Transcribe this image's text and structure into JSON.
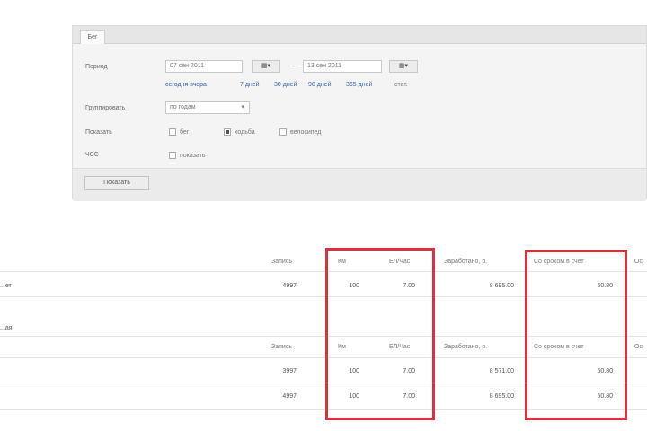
{
  "filter": {
    "tab": "Бег",
    "period_label": "Период",
    "date_from": "07 сен 2011",
    "date_to": "13 сен 2011",
    "calendar_icon": "calendar-icon",
    "dash": "—",
    "presets": [
      "сегодня  вчера",
      "7 дней",
      "30 дней",
      "90 дней",
      "365 дней",
      "стат."
    ],
    "group_label": "Группировать",
    "group_value": "по годам",
    "option_label": "Показать",
    "checks": [
      {
        "label": "бег",
        "checked": false
      },
      {
        "label": "ходьба",
        "checked": true
      },
      {
        "label": "велосипед",
        "checked": false
      }
    ],
    "extra_label": "ЧСС",
    "extra_check": {
      "label": "показать",
      "checked": false
    },
    "show_button": "Показать"
  },
  "table": {
    "section1": {
      "name": "...ет",
      "headers": [
        "Запись",
        "Км",
        "ЕЛ/Час",
        "Заработано, р.",
        "Со сроком в счет",
        "Ос"
      ],
      "rows": [
        [
          "...ет",
          "4997",
          "100",
          "7.00",
          "8 695.00",
          "50.80"
        ]
      ]
    },
    "section2": {
      "name": "...ая",
      "headers": [
        "Запись",
        "Км",
        "ЕЛ/Час",
        "Заработано, р.",
        "Со сроком в счет",
        "Ос"
      ],
      "rows": [
        [
          "",
          "3997",
          "100",
          "7.00",
          "8 571.00",
          "50.80"
        ],
        [
          "",
          "4997",
          "100",
          "7.00",
          "8 695.00",
          "50.80"
        ]
      ]
    }
  },
  "highlight_color": "#d9323c"
}
